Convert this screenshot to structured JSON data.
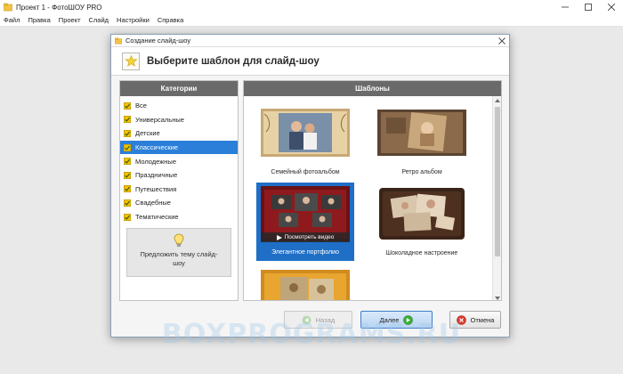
{
  "window": {
    "title": "Проект 1 - ФотоШОУ PRO",
    "app_icon": "folder-icon"
  },
  "menu": [
    {
      "label": "Файл"
    },
    {
      "label": "Правка"
    },
    {
      "label": "Проект"
    },
    {
      "label": "Слайд"
    },
    {
      "label": "Настройки"
    },
    {
      "label": "Справка"
    }
  ],
  "dialog": {
    "title": "Создание слайд-шоу",
    "header": "Выберите шаблон для слайд-шоу",
    "categories_header": "Категории",
    "templates_header": "Шаблоны",
    "categories": [
      {
        "label": "Все",
        "selected": false
      },
      {
        "label": "Универсальные",
        "selected": false
      },
      {
        "label": "Детские",
        "selected": false
      },
      {
        "label": "Классические",
        "selected": true
      },
      {
        "label": "Молодежные",
        "selected": false
      },
      {
        "label": "Праздничные",
        "selected": false
      },
      {
        "label": "Путешествия",
        "selected": false
      },
      {
        "label": "Свадебные",
        "selected": false
      },
      {
        "label": "Тематические",
        "selected": false
      }
    ],
    "suggest": "Предложить тему слайд-шоу",
    "templates": [
      {
        "label": "Семейный фотоальбом",
        "selected": false
      },
      {
        "label": "Ретро альбом",
        "selected": false
      },
      {
        "label": "Элегантное портфолио",
        "selected": true,
        "preview_label": "Посмотреть видео"
      },
      {
        "label": "Шоколадное настроение",
        "selected": false
      },
      {
        "label": "",
        "selected": false
      }
    ],
    "buttons": {
      "back": "Назад",
      "next": "Далее",
      "cancel": "Отмена"
    }
  },
  "watermark": "BOXPROGRAMS.RU",
  "colors": {
    "selection": "#2b7fd8",
    "panel_header": "#6a6a6a",
    "checkbox": "#e8b800"
  }
}
